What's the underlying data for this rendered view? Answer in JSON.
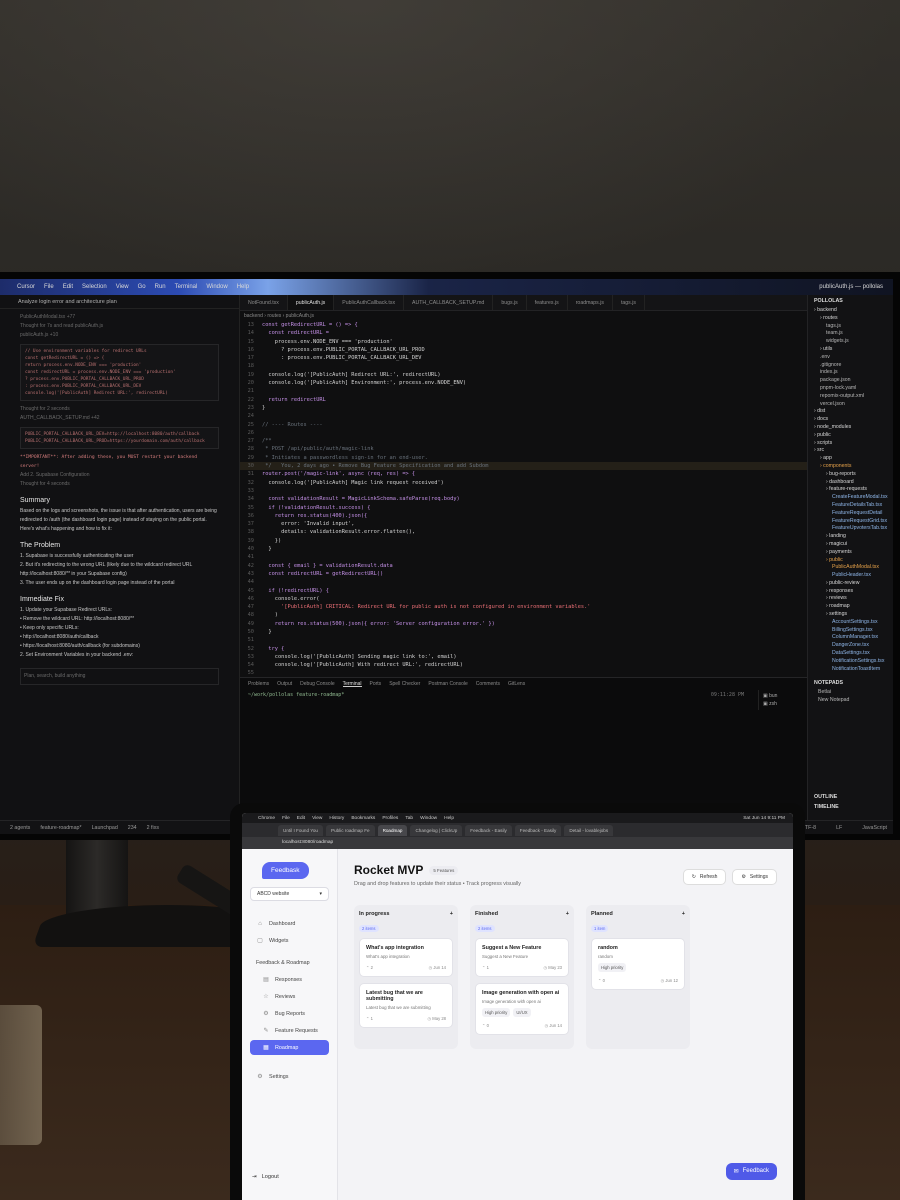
{
  "monitor": {
    "mac_menu": [
      "Cursor",
      "File",
      "Edit",
      "Selection",
      "View",
      "Go",
      "Run",
      "Terminal",
      "Window",
      "Help"
    ],
    "window_title": "publicAuth.js — pollolas",
    "chat": {
      "header": "Analyze login error and architecture plan",
      "file_ref": "PublicAuthModal.tsx +77",
      "thought1": "Thought for 7s and read publicAuth.js",
      "file_ref2": "publicAuth.js +10",
      "code1": [
        "// Use environment variables for redirect URLs",
        "const getRedirectURL = () => {",
        "  return process.env.NODE_ENV === 'production'",
        "  const redirectURL = process.env.NODE_ENV === 'production'",
        "    ? process.env.PUBLIC_PORTAL_CALLBACK_URL_PROD",
        "    : process.env.PUBLIC_PORTAL_CALLBACK_URL_DEV",
        "  console.log('[PublicAuth] Redirect URL:', redirectURL)"
      ],
      "thought2": "Thought for 2 seconds",
      "file_ref3": "AUTH_CALLBACK_SETUP.md +42",
      "code2": [
        "PUBLIC_PORTAL_CALLBACK_URL_DEV=http://localhost:8080/auth/callback",
        "PUBLIC_PORTAL_CALLBACK_URL_PROD=https://yourdomain.com/auth/callback"
      ],
      "warn": "**IMPORTANT**: After adding these, you MUST restart your backend server!",
      "section": "Add 2. Supabase Configuration",
      "thought3": "Thought for 4 seconds",
      "summary_h": "Summary",
      "summary_p": "Based on the logs and screenshots, the issue is that after authentication, users are being redirected to /auth (the dashboard login page) instead of staying on the public portal. Here's what's happening and how to fix it:",
      "problem_h": "The Problem",
      "problems": [
        "1. Supabase is successfully authenticating the user",
        "2. But it's redirecting to the wrong URL (likely due to the wildcard redirect URL http://localhost:8080/** in your Supabase config)",
        "3. The user ends up on the dashboard login page instead of the portal"
      ],
      "fix_h": "Immediate Fix",
      "fixes": [
        "1. Update your Supabase Redirect URLs:",
        "• Remove the wildcard URL: http://localhost:8080/**",
        "• Keep only specific URLs:",
        "• http://localhost:8080/auth/callback",
        "• https://localhost:8080/auth/callback (for subdomains)",
        "2. Set Environment Variables in your backend .env:"
      ],
      "input_placeholder": "Plan, search, build anything"
    },
    "tabs": [
      "NotFound.tsx",
      "publicAuth.js",
      "PublicAuthCallback.tsx",
      "AUTH_CALLBACK_SETUP.md",
      "bugs.js",
      "features.js",
      "roadmaps.js",
      "tags.js"
    ],
    "breadcrumb": "backend › routes › publicAuth.js",
    "code_lines": [
      {
        "n": "13",
        "t": "const getRedirectURL = () => {"
      },
      {
        "n": "14",
        "t": "  const redirectURL ="
      },
      {
        "n": "15",
        "t": "    process.env.NODE_ENV === 'production'"
      },
      {
        "n": "16",
        "t": "      ? process.env.PUBLIC_PORTAL_CALLBACK_URL_PROD"
      },
      {
        "n": "17",
        "t": "      : process.env.PUBLIC_PORTAL_CALLBACK_URL_DEV"
      },
      {
        "n": "18",
        "t": ""
      },
      {
        "n": "19",
        "t": "  console.log('[PublicAuth] Redirect URL:', redirectURL)"
      },
      {
        "n": "20",
        "t": "  console.log('[PublicAuth] Environment:', process.env.NODE_ENV)"
      },
      {
        "n": "21",
        "t": ""
      },
      {
        "n": "22",
        "t": "  return redirectURL"
      },
      {
        "n": "23",
        "t": "}"
      },
      {
        "n": "24",
        "t": ""
      },
      {
        "n": "25",
        "t": "// ---- Routes ----"
      },
      {
        "n": "26",
        "t": ""
      },
      {
        "n": "27",
        "t": "/**"
      },
      {
        "n": "28",
        "t": " * POST /api/public/auth/magic-link"
      },
      {
        "n": "29",
        "t": " * Initiates a passwordless sign-in for an end-user."
      },
      {
        "n": "30",
        "t": " */   You, 2 days ago • Remove Bug Feature Specification and add Subdom"
      },
      {
        "n": "31",
        "t": "router.post('/magic-link', async (req, res) => {"
      },
      {
        "n": "32",
        "t": "  console.log('[PublicAuth] Magic link request received')"
      },
      {
        "n": "33",
        "t": ""
      },
      {
        "n": "34",
        "t": "  const validationResult = MagicLinkSchema.safeParse(req.body)"
      },
      {
        "n": "35",
        "t": "  if (!validationResult.success) {"
      },
      {
        "n": "36",
        "t": "    return res.status(400).json({"
      },
      {
        "n": "37",
        "t": "      error: 'Invalid input',"
      },
      {
        "n": "38",
        "t": "      details: validationResult.error.flatten(),"
      },
      {
        "n": "39",
        "t": "    })"
      },
      {
        "n": "40",
        "t": "  }"
      },
      {
        "n": "41",
        "t": ""
      },
      {
        "n": "42",
        "t": "  const { email } = validationResult.data"
      },
      {
        "n": "43",
        "t": "  const redirectURL = getRedirectURL()"
      },
      {
        "n": "44",
        "t": ""
      },
      {
        "n": "45",
        "t": "  if (!redirectURL) {"
      },
      {
        "n": "46",
        "t": "    console.error("
      },
      {
        "n": "47",
        "t": "      '[PublicAuth] CRITICAL: Redirect URL for public auth is not configured in environment variables.'"
      },
      {
        "n": "48",
        "t": "    )"
      },
      {
        "n": "49",
        "t": "    return res.status(500).json({ error: 'Server configuration error.' })"
      },
      {
        "n": "50",
        "t": "  }"
      },
      {
        "n": "51",
        "t": ""
      },
      {
        "n": "52",
        "t": "  try {"
      },
      {
        "n": "53",
        "t": "    console.log('[PublicAuth] Sending magic link to:', email)"
      },
      {
        "n": "54",
        "t": "    console.log('[PublicAuth] With redirect URL:', redirectURL)"
      },
      {
        "n": "55",
        "t": ""
      },
      {
        "n": "56",
        "t": "    const { error } = await supabaseService.auth.signInWithOtp({"
      },
      {
        "n": "57",
        "t": "      email,"
      },
      {
        "n": "58",
        "t": "      options: {"
      },
      {
        "n": "59",
        "t": "        data: {"
      }
    ],
    "panel_tabs": [
      "Problems",
      "Output",
      "Debug Console",
      "Terminal",
      "Ports",
      "Spell Checker",
      "Postman Console",
      "Comments",
      "GitLens"
    ],
    "terminal_prompt": "~/work/pollolas feature-roadmap*",
    "terminal_time": "09:11:28 PM",
    "terminal_sessions": [
      "bun",
      "zsh"
    ],
    "explorer": {
      "title": "POLLOLAS",
      "items": [
        {
          "t": "backend",
          "k": "dir",
          "d": 0
        },
        {
          "t": "routes",
          "k": "dir",
          "d": 1
        },
        {
          "t": "tags.js",
          "k": "f",
          "d": 2
        },
        {
          "t": "team.js",
          "k": "f",
          "d": 2
        },
        {
          "t": "widgets.js",
          "k": "f",
          "d": 2
        },
        {
          "t": "utils",
          "k": "dir",
          "d": 1
        },
        {
          "t": ".env",
          "k": "f",
          "d": 1
        },
        {
          "t": ".gitignore",
          "k": "f",
          "d": 1
        },
        {
          "t": "index.js",
          "k": "f",
          "d": 1
        },
        {
          "t": "package.json",
          "k": "f",
          "d": 1
        },
        {
          "t": "pnpm-lock.yaml",
          "k": "f",
          "d": 1
        },
        {
          "t": "repomix-output.xml",
          "k": "f",
          "d": 1
        },
        {
          "t": "vercel.json",
          "k": "f",
          "d": 1
        },
        {
          "t": "dist",
          "k": "dir",
          "d": 0
        },
        {
          "t": "docs",
          "k": "dir",
          "d": 0
        },
        {
          "t": "node_modules",
          "k": "dir",
          "d": 0
        },
        {
          "t": "public",
          "k": "dir",
          "d": 0
        },
        {
          "t": "scripts",
          "k": "dir",
          "d": 0
        },
        {
          "t": "src",
          "k": "dir",
          "d": 0
        },
        {
          "t": "app",
          "k": "dir",
          "d": 1
        },
        {
          "t": "components",
          "k": "sel",
          "d": 1
        },
        {
          "t": "bug-reports",
          "k": "dir",
          "d": 2
        },
        {
          "t": "dashboard",
          "k": "dir",
          "d": 2
        },
        {
          "t": "feature-requests",
          "k": "dir",
          "d": 2
        },
        {
          "t": "CreateFeatureModal.tsx",
          "k": "tsx",
          "d": 3
        },
        {
          "t": "FeatureDetailsTab.tsx",
          "k": "tsx",
          "d": 3
        },
        {
          "t": "FeatureRequestDetail",
          "k": "tsx",
          "d": 3
        },
        {
          "t": "FeatureRequestGrid.tsx",
          "k": "tsx",
          "d": 3
        },
        {
          "t": "FeatureUpvotersTab.tsx",
          "k": "tsx",
          "d": 3
        },
        {
          "t": "landing",
          "k": "dir",
          "d": 2
        },
        {
          "t": "magicui",
          "k": "dir",
          "d": 2
        },
        {
          "t": "payments",
          "k": "dir",
          "d": 2
        },
        {
          "t": "public",
          "k": "sel",
          "d": 2
        },
        {
          "t": "PublicAuthModal.tsx",
          "k": "sel",
          "d": 3
        },
        {
          "t": "PublicHeader.tsx",
          "k": "tsx",
          "d": 3
        },
        {
          "t": "public-review",
          "k": "dir",
          "d": 2
        },
        {
          "t": "responses",
          "k": "dir",
          "d": 2
        },
        {
          "t": "reviews",
          "k": "dir",
          "d": 2
        },
        {
          "t": "roadmap",
          "k": "dir",
          "d": 2
        },
        {
          "t": "settings",
          "k": "dir",
          "d": 2
        },
        {
          "t": "AccountSettings.tsx",
          "k": "tsx",
          "d": 3
        },
        {
          "t": "BillingSettings.tsx",
          "k": "tsx",
          "d": 3
        },
        {
          "t": "ColumnManager.tsx",
          "k": "tsx",
          "d": 3
        },
        {
          "t": "DangerZone.tsx",
          "k": "tsx",
          "d": 3
        },
        {
          "t": "DataSettings.tsx",
          "k": "tsx",
          "d": 3
        },
        {
          "t": "NotificationSettings.tsx",
          "k": "tsx",
          "d": 3
        },
        {
          "t": "NotificationToastItem",
          "k": "tsx",
          "d": 3
        }
      ],
      "notepads_title": "NOTEPADS",
      "notepads": [
        "Betlai",
        "New Notepad"
      ],
      "outline": "OUTLINE",
      "timeline": "TIMELINE"
    },
    "status": {
      "left": [
        "2 agents",
        "feature-roadmap*",
        "Launchpad",
        "234",
        "2 fixs"
      ],
      "right": [
        "Cursor Tab",
        "Ln 30, Col 4",
        "Tab Size: 4",
        "UTF-8",
        "LF",
        "JavaScript"
      ]
    }
  },
  "laptop": {
    "menubar": [
      "Chrome",
      "File",
      "Edit",
      "View",
      "History",
      "Bookmarks",
      "Profiles",
      "Tab",
      "Window",
      "Help"
    ],
    "menubar_right": "Sat Jun 14  9:11 PM",
    "browser_tabs": [
      "Until I Found You",
      "Public roadmap Fe",
      "Roadmap",
      "Changelog | ClickUp",
      "Feedback - Easily",
      "Feedback - Easily",
      "Detail - lovablejobs"
    ],
    "url": "localhost:8080/roadmap",
    "logo": "Feedbask",
    "site_select": "ABCD website",
    "nav": [
      {
        "label": "Dashboard",
        "icon": "⌂",
        "name": "nav-dashboard"
      },
      {
        "label": "Widgets",
        "icon": "▢",
        "name": "nav-widgets"
      },
      {
        "label": "Feedback & Roadmap",
        "icon": "",
        "name": "nav-feedback-roadmap"
      },
      {
        "label": "Responses",
        "icon": "▤",
        "name": "nav-responses"
      },
      {
        "label": "Reviews",
        "icon": "☆",
        "name": "nav-reviews"
      },
      {
        "label": "Bug Reports",
        "icon": "⚙",
        "name": "nav-bug-reports"
      },
      {
        "label": "Feature Requests",
        "icon": "✎",
        "name": "nav-feature-requests"
      },
      {
        "label": "Roadmap",
        "icon": "▦",
        "name": "nav-roadmap"
      },
      {
        "label": "Settings",
        "icon": "⚙",
        "name": "nav-settings"
      }
    ],
    "logout": "Logout",
    "title": "Rocket MVP",
    "feature_count": "5 Features",
    "subtitle": "Drag and drop features to update their status • Track progress visually",
    "refresh": "Refresh",
    "settings": "Settings",
    "columns": [
      {
        "name": "In progress",
        "count": "2 items",
        "cards": [
          {
            "title": "What's app integration",
            "desc": "What's app integration",
            "tags": [],
            "votes": "2",
            "date": "Jun 14"
          },
          {
            "title": "Latest bug that we are submitting",
            "desc": "Latest bug that we are submitting",
            "tags": [],
            "votes": "1",
            "date": "May 28"
          }
        ]
      },
      {
        "name": "Finished",
        "count": "2 items",
        "cards": [
          {
            "title": "Suggest a New Feature",
            "desc": "Suggest a New Feature",
            "tags": [],
            "votes": "1",
            "date": "May 23"
          },
          {
            "title": "Image generation with open ai",
            "desc": "Image generation with open ai",
            "tags": [
              "High priority",
              "UI/UX"
            ],
            "votes": "0",
            "date": "Jun 14"
          }
        ]
      },
      {
        "name": "Planned",
        "count": "1 item",
        "cards": [
          {
            "title": "random",
            "desc": "random",
            "tags": [
              "High priority"
            ],
            "votes": "0",
            "date": "Jun 12"
          }
        ]
      }
    ],
    "feedback_button": "Feedback"
  }
}
